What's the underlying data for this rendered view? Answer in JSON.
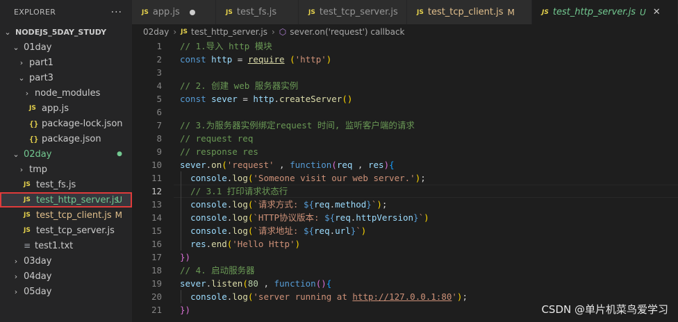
{
  "explorer": {
    "title": "EXPLORER",
    "more": "···",
    "root": "NODEJS_5DAY_STUDY",
    "rows": [
      {
        "label": "01day",
        "type": "folder-open",
        "depth": 1
      },
      {
        "label": "part1",
        "type": "folder",
        "depth": 2
      },
      {
        "label": "part3",
        "type": "folder-open",
        "depth": 2
      },
      {
        "label": "node_modules",
        "type": "folder",
        "depth": 3
      },
      {
        "label": "app.js",
        "type": "js",
        "depth": 3
      },
      {
        "label": "package-lock.json",
        "type": "json",
        "depth": 3
      },
      {
        "label": "package.json",
        "type": "json",
        "depth": 3
      },
      {
        "label": "02day",
        "type": "folder-open",
        "depth": 1,
        "color": "#73c991",
        "badge": "●"
      },
      {
        "label": "tmp",
        "type": "folder",
        "depth": 2
      },
      {
        "label": "test_fs.js",
        "type": "js",
        "depth": 2
      },
      {
        "label": "test_http_server.js",
        "type": "js",
        "depth": 2,
        "color": "#73c991",
        "badge": "U",
        "selected": true
      },
      {
        "label": "test_tcp_client.js",
        "type": "js",
        "depth": 2,
        "color": "#e2c08d",
        "badge": "M"
      },
      {
        "label": "test_tcp_server.js",
        "type": "js",
        "depth": 2
      },
      {
        "label": "test1.txt",
        "type": "txt",
        "depth": 2
      },
      {
        "label": "03day",
        "type": "folder",
        "depth": 1
      },
      {
        "label": "04day",
        "type": "folder",
        "depth": 1
      },
      {
        "label": "05day",
        "type": "folder",
        "depth": 1
      }
    ]
  },
  "tabs": [
    {
      "label": "app.js",
      "js_icon": "JS",
      "modified_dot": true
    },
    {
      "label": "test_fs.js",
      "js_icon": "JS"
    },
    {
      "label": "test_tcp_server.js",
      "js_icon": "JS"
    },
    {
      "label": "test_tcp_client.js",
      "js_icon": "JS",
      "badge": "M"
    },
    {
      "label": "test_http_server.js",
      "js_icon": "JS",
      "badge": "U",
      "active": true,
      "close": "✕"
    }
  ],
  "breadcrumb": {
    "folder": "02day",
    "file": "test_http_server.js",
    "symbol": "sever.on('request') callback"
  },
  "editor": {
    "current_line": 12,
    "lines": [
      {
        "n": "1",
        "tokens": [
          [
            "cm",
            "// 1.导入 http 模块"
          ]
        ]
      },
      {
        "n": "2",
        "tokens": [
          [
            "kw",
            "const "
          ],
          [
            "var",
            "http"
          ],
          [
            "pn",
            " = "
          ],
          [
            "fn und",
            "require"
          ],
          [
            "pn",
            " "
          ],
          [
            "br1",
            "("
          ],
          [
            "str",
            "'http'"
          ],
          [
            "br1",
            ")"
          ]
        ]
      },
      {
        "n": "3",
        "tokens": []
      },
      {
        "n": "4",
        "tokens": [
          [
            "cm",
            "// 2. 创建 web 服务器实例"
          ]
        ]
      },
      {
        "n": "5",
        "tokens": [
          [
            "kw",
            "const "
          ],
          [
            "var",
            "sever"
          ],
          [
            "pn",
            " = "
          ],
          [
            "var",
            "http"
          ],
          [
            "pn",
            "."
          ],
          [
            "fn",
            "createServer"
          ],
          [
            "br1",
            "()"
          ]
        ]
      },
      {
        "n": "6",
        "tokens": []
      },
      {
        "n": "7",
        "tokens": [
          [
            "cm",
            "// 3.为服务器实例绑定request 时间, 监听客户端的请求"
          ]
        ]
      },
      {
        "n": "8",
        "tokens": [
          [
            "cm",
            "// request req"
          ]
        ]
      },
      {
        "n": "9",
        "tokens": [
          [
            "cm",
            "// response res"
          ]
        ]
      },
      {
        "n": "10",
        "tokens": [
          [
            "var",
            "sever"
          ],
          [
            "pn",
            "."
          ],
          [
            "fn",
            "on"
          ],
          [
            "br1",
            "("
          ],
          [
            "str",
            "'request'"
          ],
          [
            "pn",
            " , "
          ],
          [
            "kw",
            "function"
          ],
          [
            "br2",
            "("
          ],
          [
            "var",
            "req"
          ],
          [
            "pn",
            " , "
          ],
          [
            "var",
            "res"
          ],
          [
            "br2",
            ")"
          ],
          [
            "br3",
            "{"
          ]
        ]
      },
      {
        "n": "11",
        "tokens": [
          [
            "pn",
            "  "
          ],
          [
            "var",
            "console"
          ],
          [
            "pn",
            "."
          ],
          [
            "fn",
            "log"
          ],
          [
            "br1",
            "("
          ],
          [
            "str",
            "'Someone visit our web server.'"
          ],
          [
            "br1",
            ")"
          ],
          [
            "pn",
            ";"
          ]
        ]
      },
      {
        "n": "12",
        "tokens": [
          [
            "pn",
            "  "
          ],
          [
            "cm",
            "// 3.1 打印请求状态行"
          ]
        ]
      },
      {
        "n": "13",
        "tokens": [
          [
            "pn",
            "  "
          ],
          [
            "var",
            "console"
          ],
          [
            "pn",
            "."
          ],
          [
            "fn",
            "log"
          ],
          [
            "br1",
            "("
          ],
          [
            "str",
            "`请求方式: "
          ],
          [
            "tpl",
            "${"
          ],
          [
            "var",
            "req"
          ],
          [
            "pn",
            "."
          ],
          [
            "var",
            "method"
          ],
          [
            "tpl",
            "}"
          ],
          [
            "str",
            "`"
          ],
          [
            "br1",
            ")"
          ],
          [
            "pn",
            ";"
          ]
        ]
      },
      {
        "n": "14",
        "tokens": [
          [
            "pn",
            "  "
          ],
          [
            "var",
            "console"
          ],
          [
            "pn",
            "."
          ],
          [
            "fn",
            "log"
          ],
          [
            "br1",
            "("
          ],
          [
            "str",
            "`HTTP协议版本: "
          ],
          [
            "tpl",
            "${"
          ],
          [
            "var",
            "req"
          ],
          [
            "pn",
            "."
          ],
          [
            "var",
            "httpVersion"
          ],
          [
            "tpl",
            "}"
          ],
          [
            "str",
            "`"
          ],
          [
            "br1",
            ")"
          ]
        ]
      },
      {
        "n": "15",
        "tokens": [
          [
            "pn",
            "  "
          ],
          [
            "var",
            "console"
          ],
          [
            "pn",
            "."
          ],
          [
            "fn",
            "log"
          ],
          [
            "br1",
            "("
          ],
          [
            "str",
            "`请求地址: "
          ],
          [
            "tpl",
            "${"
          ],
          [
            "var",
            "req"
          ],
          [
            "pn",
            "."
          ],
          [
            "var",
            "url"
          ],
          [
            "tpl",
            "}"
          ],
          [
            "str",
            "`"
          ],
          [
            "br1",
            ")"
          ]
        ]
      },
      {
        "n": "16",
        "tokens": [
          [
            "pn",
            "  "
          ],
          [
            "var",
            "res"
          ],
          [
            "pn",
            "."
          ],
          [
            "fn",
            "end"
          ],
          [
            "br1",
            "("
          ],
          [
            "str",
            "'Hello Http'"
          ],
          [
            "br1",
            ")"
          ]
        ]
      },
      {
        "n": "17",
        "tokens": [
          [
            "br2",
            "})"
          ]
        ]
      },
      {
        "n": "18",
        "tokens": [
          [
            "cm",
            "// 4. 启动服务器"
          ]
        ]
      },
      {
        "n": "19",
        "tokens": [
          [
            "var",
            "sever"
          ],
          [
            "pn",
            "."
          ],
          [
            "fn",
            "listen"
          ],
          [
            "br1",
            "("
          ],
          [
            "num",
            "80"
          ],
          [
            "pn",
            " , "
          ],
          [
            "kw",
            "function"
          ],
          [
            "br2",
            "()"
          ],
          [
            "br3",
            "{"
          ]
        ]
      },
      {
        "n": "20",
        "tokens": [
          [
            "pn",
            "  "
          ],
          [
            "var",
            "console"
          ],
          [
            "pn",
            "."
          ],
          [
            "fn",
            "log"
          ],
          [
            "br1",
            "("
          ],
          [
            "str",
            "'server running at "
          ],
          [
            "str und",
            "http://127.0.0.1:80"
          ],
          [
            "str",
            "'"
          ],
          [
            "br1",
            ")"
          ],
          [
            "pn",
            ";"
          ]
        ]
      },
      {
        "n": "21",
        "tokens": [
          [
            "br2",
            "})"
          ]
        ]
      }
    ]
  },
  "watermark": "CSDN @单片机菜鸟爱学习",
  "colors": {
    "accent_untracked": "#73c991",
    "accent_modified": "#e2c08d",
    "selection_outline": "#e03b3b"
  }
}
